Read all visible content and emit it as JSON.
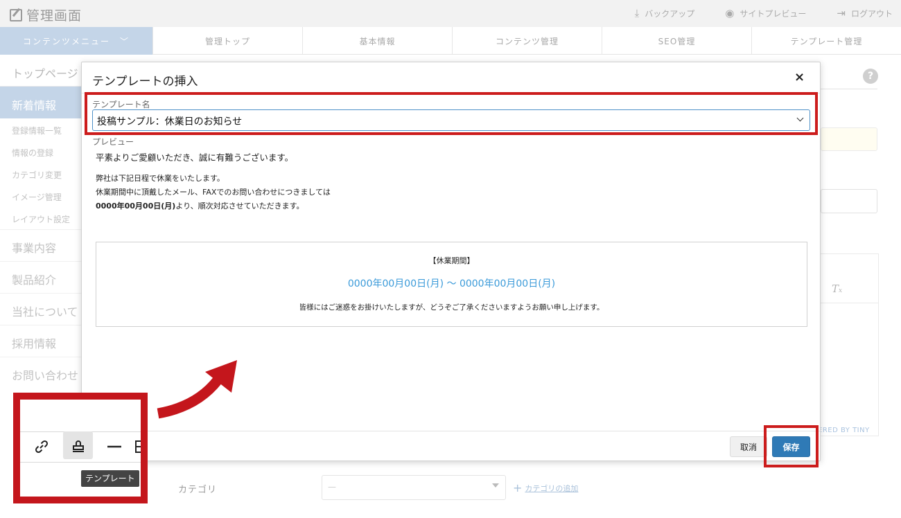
{
  "app": {
    "logo_text": "管理画面"
  },
  "top_links": [
    {
      "label": "バックアップ",
      "icon": "download-icon"
    },
    {
      "label": "サイトプレビュー",
      "icon": "eye-icon"
    },
    {
      "label": "ログアウト",
      "icon": "logout-icon"
    }
  ],
  "nav": {
    "menu_label": "コンテンツメニュー",
    "items": [
      "管理トップ",
      "基本情報",
      "コンテンツ管理",
      "SEO管理",
      "テンプレート管理"
    ]
  },
  "sidebar": {
    "page_title": "トップページ",
    "active_item": "新着情報",
    "sub_items": [
      "登録情報一覧",
      "情報の登録",
      "カテゴリ変更",
      "イメージ管理",
      "レイアウト設定"
    ],
    "main_items": [
      "事業内容",
      "製品紹介",
      "当社について",
      "採用情報",
      "お問い合わせ"
    ]
  },
  "background": {
    "powered_by": "ERED BY TINY",
    "category_label": "カテゴリ",
    "category_value": "—",
    "category_add": "カテゴリの追加"
  },
  "modal": {
    "title": "テンプレートの挿入",
    "template_name_label": "テンプレート名",
    "template_selected": "投稿サンプル：休業日のお知らせ",
    "preview_label": "プレビュー",
    "preview": {
      "greeting": "平素よりご愛顧いただき、誠に有難うございます。",
      "line2": "弊社は下記日程で休業をいたします。",
      "line3": "休業期間中に頂戴したメール、FAXでのお問い合わせにつきましては",
      "line4_bold": "0000年00月00日(月)",
      "line4_rest": "より、順次対応させていただきます。",
      "box_title": "【休業期間】",
      "box_dates": "0000年00月00日(月) 〜 0000年00月00日(月)",
      "box_apology": "皆様にはご迷惑をお掛けいたしますが、どうぞご了承くださいますようお願い申し上げます。"
    },
    "cancel_label": "取消",
    "save_label": "保存",
    "close_label": "×"
  },
  "callout": {
    "tooltip": "テンプレート"
  },
  "colors": {
    "accent_blue": "#2f7ab6",
    "link_blue": "#3a9ad9",
    "highlight_red": "#cc1c1c",
    "menu_blue": "#c4d5e8"
  }
}
